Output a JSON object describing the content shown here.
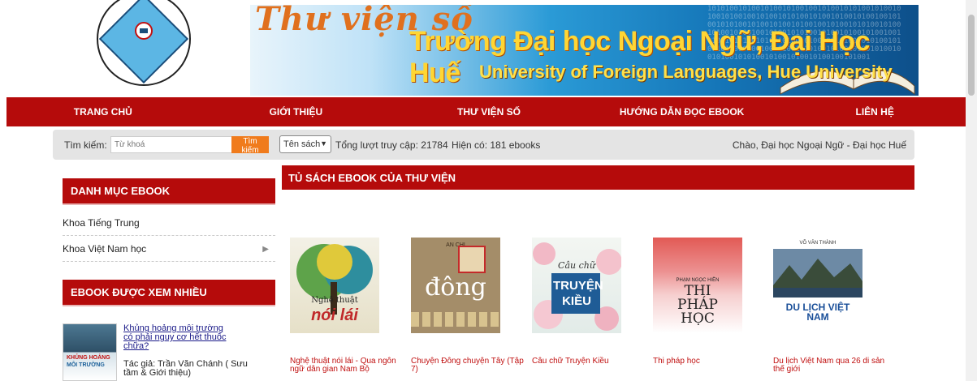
{
  "banner": {
    "logo_text": "TRƯỜNG ĐẠI HỌC NGOẠI NGỮ",
    "script_title": "Thư viện số",
    "title_vi": "Trường Đại học Ngoại Ngữ, Đại Học Huế",
    "title_en": "University of Foreign Languages, Hue University"
  },
  "nav": {
    "items": [
      "TRANG CHỦ",
      "GIỚI THIỆU",
      "THƯ VIỆN SỐ",
      "HƯỚNG DẪN ĐỌC EBOOK",
      "LIÊN HỆ"
    ]
  },
  "search": {
    "label": "Tìm kiếm:",
    "placeholder": "Từ khoá",
    "button": "Tìm kiếm",
    "select_value": "Tên sách",
    "access_count": "Tổng lượt truy cập: 21784",
    "ebook_count": "Hiện có: 181 ebooks",
    "greeting": "Chào, Đại học Ngoại Ngữ - Đại học Huế"
  },
  "sidebar": {
    "categories_heading": "DANH MỤC EBOOK",
    "categories": [
      "Khoa Tiếng Trung",
      "Khoa Việt Nam học"
    ],
    "popular_heading": "EBOOK ĐƯỢC XEM NHIỀU",
    "popular": [
      {
        "title": "Khủng hoảng môi trường có phải nguy cơ hết thuốc chữa?",
        "author": "Tác giả: Trần Văn Chánh ( Sưu tầm & Giới thiệu)",
        "cover_line1": "KHỦNG HOẢNG",
        "cover_line2": "MÔI TRƯỜNG"
      }
    ]
  },
  "main": {
    "heading": "TỦ SÁCH EBOOK CỦA THƯ VIỆN",
    "books": [
      {
        "title": "Nghệ thuật nói lái - Qua ngôn ngữ dân gian Nam Bộ",
        "cover_top": "Nghệ thuật",
        "cover_main": "nói lái"
      },
      {
        "title": "Chuyện Đông chuyện Tây (Tập 7)",
        "cover_top": "AN CHI",
        "cover_main": "đông"
      },
      {
        "title": "Câu chữ Truyện Kiều",
        "cover_top": "Câu chữ",
        "cover_main": "TRUYỆN KIỀU"
      },
      {
        "title": "Thi pháp học",
        "cover_top": "PHẠM NGỌC HIỀN",
        "cover_main": "THI PHÁP HỌC"
      },
      {
        "title": "Du lịch Việt Nam qua 26 di sản thế giới",
        "cover_top": "VÕ VĂN THÀNH",
        "cover_main": "DU LỊCH VIỆT NAM"
      }
    ]
  }
}
